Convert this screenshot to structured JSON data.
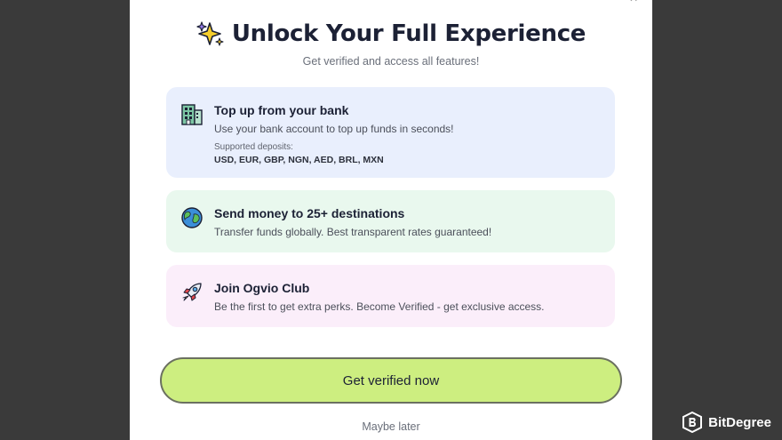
{
  "modal": {
    "close_label": "×",
    "title": "Unlock Your Full Experience",
    "subtitle": "Get verified and access all features!",
    "title_icon": "sparkles-icon"
  },
  "cards": [
    {
      "icon": "bank-building-icon",
      "title": "Top up from your bank",
      "description": "Use your bank account to top up funds in seconds!",
      "note": "Supported deposits:",
      "currencies": "USD, EUR, GBP, NGN, AED, BRL, MXN",
      "background": "#e9effd"
    },
    {
      "icon": "globe-icon",
      "title": "Send money to 25+ destinations",
      "description": "Transfer funds globally. Best transparent rates guaranteed!",
      "background": "#e9f8ee"
    },
    {
      "icon": "rocket-icon",
      "title": "Join Ogvio Club",
      "description": "Be the first to get extra perks. Become Verified - get exclusive access.",
      "background": "#fbeefa"
    }
  ],
  "actions": {
    "primary_label": "Get verified now",
    "secondary_label": "Maybe later",
    "primary_color": "#cdee80"
  },
  "watermark": {
    "text": "BitDegree",
    "icon": "bitdegree-logo-icon"
  }
}
